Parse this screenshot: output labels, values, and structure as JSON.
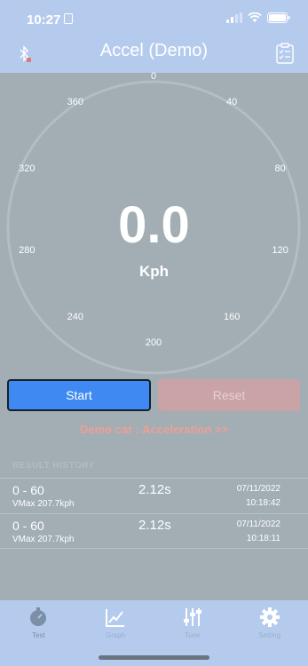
{
  "status_bar": {
    "time": "10:27"
  },
  "nav": {
    "title": "Accel (Demo)",
    "left_icon": "bluetooth-icon",
    "right_icon": "clipboard-icon"
  },
  "gauge": {
    "speed": "0.0",
    "unit": "Kph",
    "ticks": [
      "0",
      "40",
      "80",
      "120",
      "160",
      "200",
      "240",
      "280",
      "320",
      "360"
    ]
  },
  "buttons": {
    "start_label": "Start",
    "reset_label": "Reset"
  },
  "demo_link": "Demo car : Acceleration >>",
  "history": {
    "heading": "RESULT HISTORY",
    "rows": [
      {
        "range": "0 - 60",
        "vmax": "VMax 207.7kph",
        "time": "2.12s",
        "date": "07/11/2022",
        "clock": "10:18:42"
      },
      {
        "range": "0 - 60",
        "vmax": "VMax 207.7kph",
        "time": "2.12s",
        "date": "07/11/2022",
        "clock": "10:18:11"
      }
    ]
  },
  "tabs": [
    {
      "label": "Test",
      "icon": "stopwatch-icon"
    },
    {
      "label": "Graph",
      "icon": "chart-icon"
    },
    {
      "label": "Tune",
      "icon": "sliders-icon"
    },
    {
      "label": "Setting",
      "icon": "gear-icon"
    }
  ],
  "colors": {
    "header": "#b5cbee",
    "body": "#a2adb4",
    "start": "#3f8af2",
    "reset": "#c9a3a6",
    "demo_link": "#eda098"
  }
}
